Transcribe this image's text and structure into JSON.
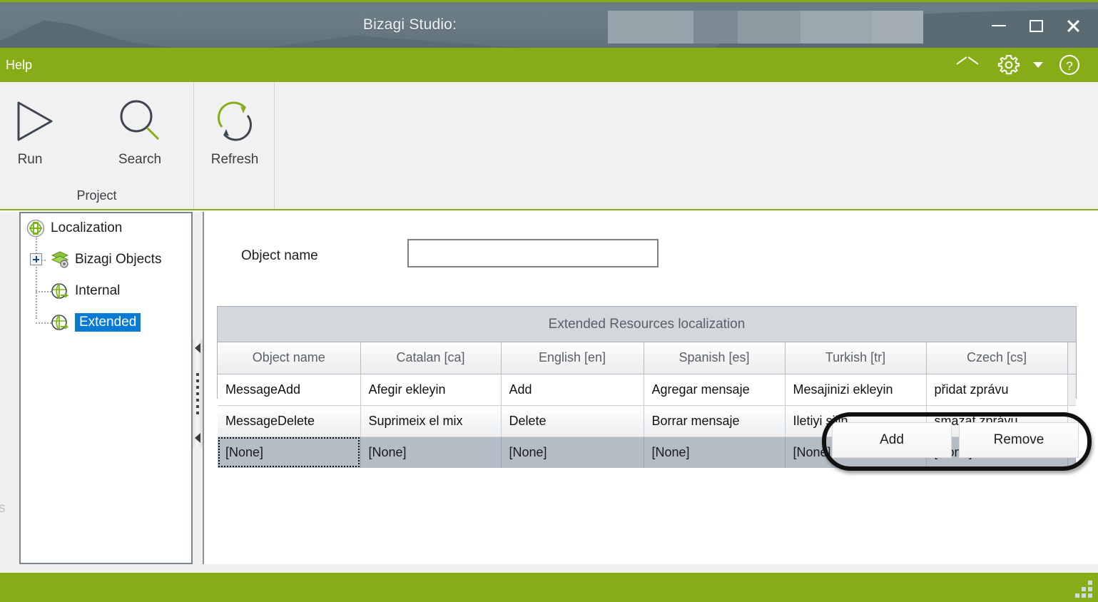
{
  "window": {
    "title": "Bizagi Studio:",
    "minimize_label": "Minimize",
    "maximize_label": "Maximize",
    "close_label": "Close"
  },
  "menubar": {
    "help_label": "Help",
    "collapse_ribbon_label": "Collapse Ribbon",
    "settings_label": "Settings",
    "settings_caret_label": "Settings options",
    "help_circle_label": "Help"
  },
  "ribbon": {
    "groups": [
      {
        "title": "Project",
        "buttons": [
          {
            "label": "Run",
            "icon": "play-icon"
          },
          {
            "label": "Search",
            "icon": "search-icon"
          }
        ]
      },
      {
        "title": "",
        "buttons": [
          {
            "label": "Refresh",
            "icon": "refresh-icon"
          }
        ]
      }
    ]
  },
  "tree": {
    "nodes": [
      {
        "label": "Localization",
        "icon": "localization-icon",
        "selected": false,
        "expander": "none"
      },
      {
        "label": "Bizagi Objects",
        "icon": "objects-stack-icon",
        "selected": false,
        "expander": "plus"
      },
      {
        "label": "Internal",
        "icon": "globe-arrow-icon",
        "selected": false,
        "expander": "none"
      },
      {
        "label": "Extended",
        "icon": "globe-arrow-icon",
        "selected": true,
        "expander": "none"
      }
    ]
  },
  "form": {
    "object_name_label": "Object name",
    "object_name_value": "",
    "object_name_placeholder": ""
  },
  "grid": {
    "caption": "Extended Resources localization",
    "columns": [
      "Object name",
      "Catalan [ca]",
      "English [en]",
      "Spanish [es]",
      "Turkish [tr]",
      "Czech [cs]"
    ],
    "rows": [
      {
        "cells": [
          "MessageAdd",
          "Afegir ekleyin",
          "Add",
          "Agregar mensaje",
          "Mesajinizi ekleyin",
          "přidat zprávu"
        ],
        "state": "normal"
      },
      {
        "cells": [
          "MessageDelete",
          "Suprimeix el mix",
          "Delete",
          "Borrar mensaje",
          "Iletiyi silin",
          "smazat zprávu"
        ],
        "state": "alt"
      },
      {
        "cells": [
          "[None]",
          "[None]",
          "[None]",
          "[None]",
          "[None]",
          "[None]"
        ],
        "state": "newrow"
      }
    ]
  },
  "actions": {
    "add_label": "Add",
    "remove_label": "Remove"
  },
  "edge": {
    "clipped_text": "s"
  },
  "colors": {
    "brand_green": "#86ac17",
    "titlebar_slate": "#67777f",
    "selection_blue": "#0a7bd4",
    "grid_header": "#d4d8dd",
    "new_row": "#b4bcc6"
  }
}
